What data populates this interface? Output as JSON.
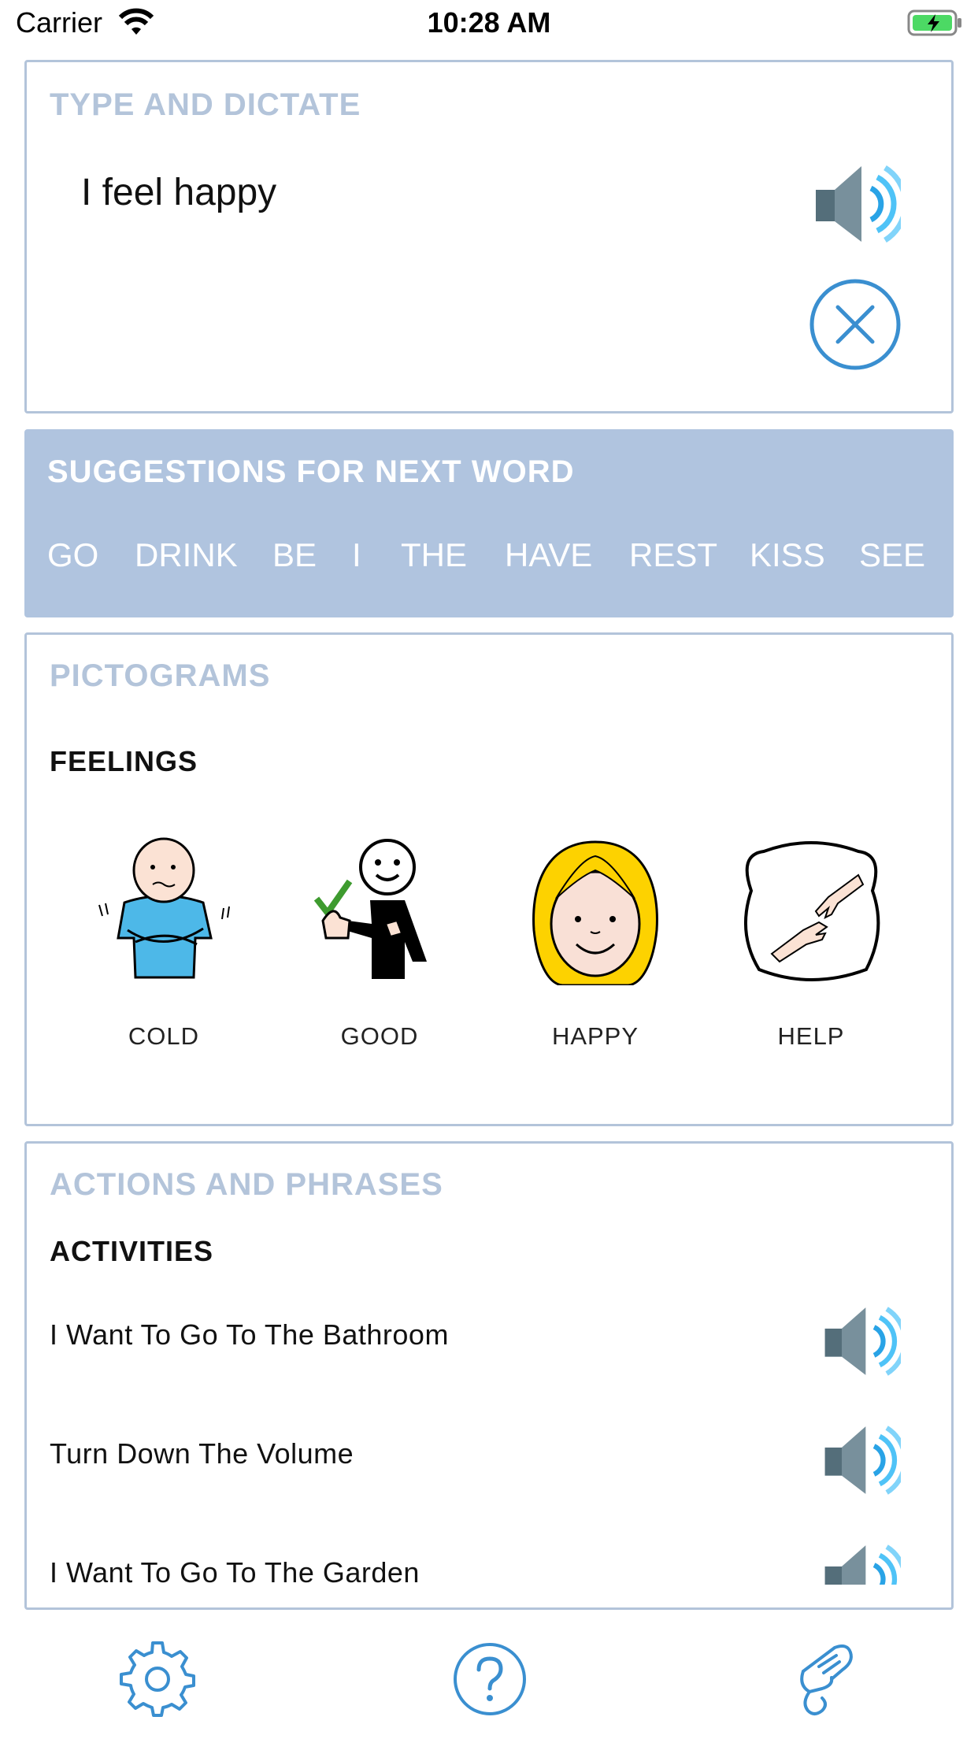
{
  "status_bar": {
    "carrier": "Carrier",
    "time": "10:28 AM"
  },
  "type_panel": {
    "title": "TYPE AND DICTATE",
    "text": "I feel happy",
    "speak_icon": "speaker-icon",
    "clear_icon": "close-circle-icon"
  },
  "suggestions": {
    "title": "SUGGESTIONS FOR NEXT WORD",
    "words": [
      "GO",
      "DRINK",
      "BE",
      "I",
      "THE",
      "HAVE",
      "REST",
      "KISS",
      "SEE"
    ]
  },
  "pictograms": {
    "title": "PICTOGRAMS",
    "category": "FEELINGS",
    "items": [
      {
        "label": "COLD",
        "icon": "cold-person-icon"
      },
      {
        "label": "GOOD",
        "icon": "thumbs-up-person-icon"
      },
      {
        "label": "HAPPY",
        "icon": "happy-girl-face-icon"
      },
      {
        "label": "HELP",
        "icon": "helping-hands-icon"
      }
    ]
  },
  "actions": {
    "title": "ACTIONS AND PHRASES",
    "category": "ACTIVITIES",
    "phrases": [
      "I Want To Go To The Bathroom",
      "Turn Down The Volume",
      "I Want To Go To The Garden"
    ]
  },
  "tab_bar": {
    "items": [
      "gear-icon",
      "help-circle-icon",
      "sign-hand-icon"
    ]
  },
  "colors": {
    "accent": "#3a8fd0",
    "panel_border": "#b3c4da",
    "suggest_bg": "#b0c4df",
    "title_muted": "#b3c4da"
  }
}
